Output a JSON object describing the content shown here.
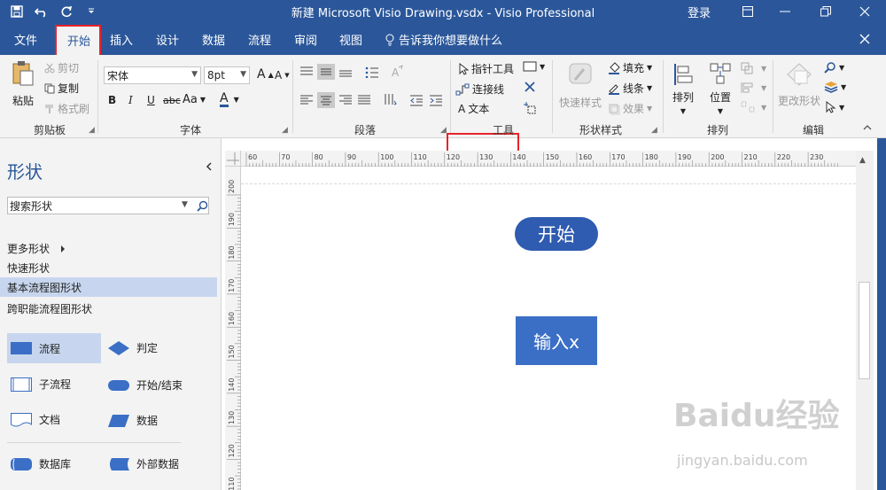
{
  "window": {
    "title": "新建 Microsoft Visio Drawing.vsdx  -  Visio Professional",
    "login": "登录"
  },
  "tabs": [
    "文件",
    "开始",
    "插入",
    "设计",
    "数据",
    "流程",
    "审阅",
    "视图"
  ],
  "tell_me": "告诉我你想要做什么",
  "ribbon": {
    "clipboard": {
      "paste": "粘贴",
      "cut": "剪切",
      "copy": "复制",
      "format_painter": "格式刷",
      "label": "剪贴板"
    },
    "font": {
      "name": "宋体",
      "size": "8pt",
      "bold": "B",
      "italic": "I",
      "underline": "U",
      "strike": "abc",
      "case": "Aa",
      "color": "A",
      "grow": "A",
      "shrink": "A",
      "label": "字体"
    },
    "paragraph": {
      "label": "段落"
    },
    "tools": {
      "pointer": "指针工具",
      "connector": "连接线",
      "text": "文本",
      "label": "工具"
    },
    "shape_styles": {
      "quick_styles": "快速样式",
      "fill": "填充",
      "line": "线条",
      "effects": "效果",
      "label": "形状样式"
    },
    "arrange": {
      "arrange": "排列",
      "position": "位置",
      "label": "排列"
    },
    "editing": {
      "change_shape": "更改形状",
      "label": "编辑"
    }
  },
  "shapes_panel": {
    "title": "形状",
    "search_value": "搜索形状",
    "more_shapes": "更多形状",
    "items": [
      "快速形状",
      "基本流程图形状",
      "跨职能流程图形状"
    ],
    "stencils": [
      "流程",
      "判定",
      "子流程",
      "开始/结束",
      "文档",
      "数据",
      "数据库",
      "外部数据"
    ]
  },
  "ruler": {
    "top": [
      "60",
      "70",
      "80",
      "90",
      "100",
      "110",
      "120",
      "130",
      "140",
      "150",
      "160",
      "170",
      "180",
      "190",
      "200",
      "210",
      "220",
      "230"
    ],
    "left": [
      "200",
      "190",
      "180",
      "170",
      "160",
      "150",
      "140",
      "130",
      "120",
      "110"
    ]
  },
  "canvas": {
    "start_shape": "开始",
    "input_shape": "输入x"
  },
  "watermark": {
    "logo": "Baidu经验",
    "url": "jingyan.baidu.com"
  },
  "colors": {
    "accent": "#2b579a",
    "shape_fill": "#2f5bb0",
    "highlight": "#e8232a"
  }
}
